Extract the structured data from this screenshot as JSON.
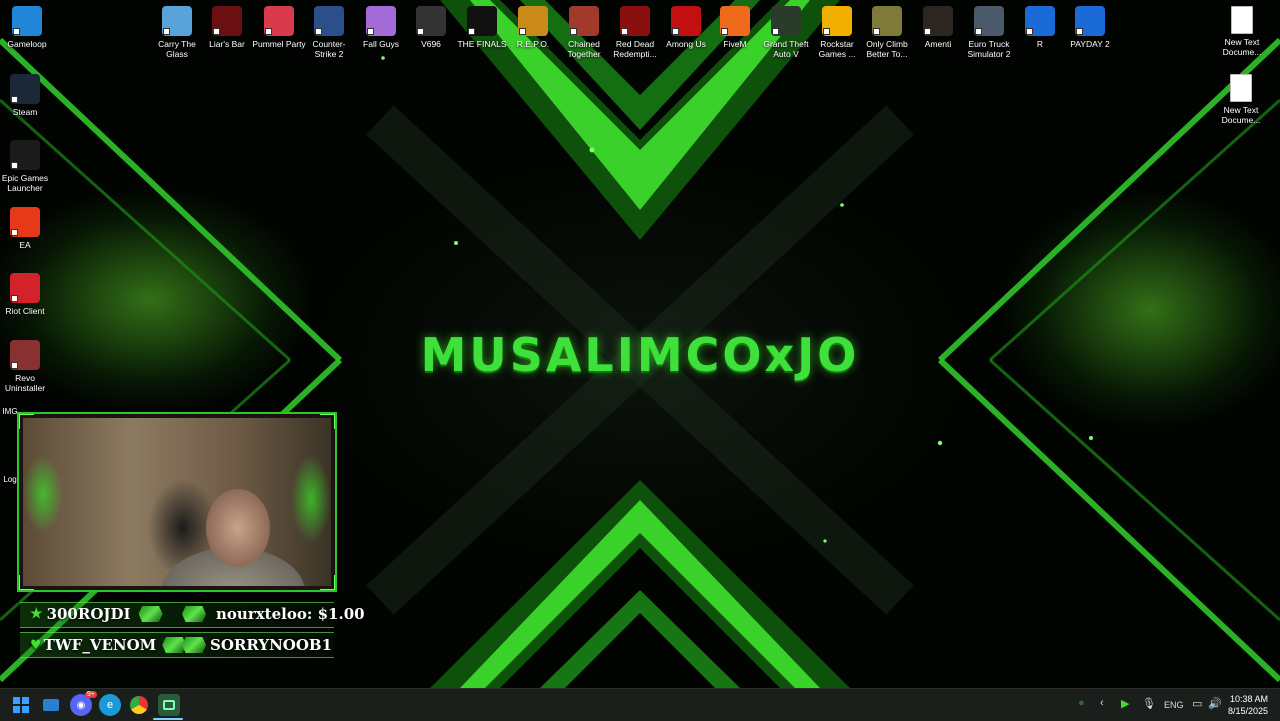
{
  "wallpaper": {
    "title": "MUSALIMCOxJO"
  },
  "desktop_icons_top": [
    {
      "label": "Gameloop",
      "icon": "gameloop-icon",
      "color": "#1f86d8"
    },
    {
      "label": "Carry The Glass",
      "icon": "carry-the-glass-icon",
      "color": "#5aa3d8"
    },
    {
      "label": "Liar's Bar",
      "icon": "liars-bar-icon",
      "color": "#6a0f12"
    },
    {
      "label": "Pummel Party",
      "icon": "pummel-party-icon",
      "color": "#d93a4e"
    },
    {
      "label": "Counter-Strike 2",
      "icon": "counter-strike-icon",
      "color": "#2a4f8a"
    },
    {
      "label": "Fall Guys",
      "icon": "fall-guys-icon",
      "color": "#a46ad8"
    },
    {
      "label": "V696",
      "icon": "v696-icon",
      "color": "#333333"
    },
    {
      "label": "THE FINALS",
      "icon": "the-finals-icon",
      "color": "#111111"
    },
    {
      "label": "R.E.P.O.",
      "icon": "repo-icon",
      "color": "#c98a1a"
    },
    {
      "label": "Chained Together",
      "icon": "chained-together-icon",
      "color": "#a13a2a"
    },
    {
      "label": "Red Dead Redempti...",
      "icon": "red-dead-icon",
      "color": "#8a1010"
    },
    {
      "label": "Among Us",
      "icon": "among-us-icon",
      "color": "#c21010"
    },
    {
      "label": "FiveM",
      "icon": "fivem-icon",
      "color": "#f06a1c"
    },
    {
      "label": "Grand Theft Auto V",
      "icon": "gta-v-icon",
      "color": "#2b3b2b"
    },
    {
      "label": "Rockstar Games ...",
      "icon": "rockstar-icon",
      "color": "#f1b000"
    },
    {
      "label": "Only Climb Better To...",
      "icon": "only-climb-icon",
      "color": "#7d7a3a"
    },
    {
      "label": "Amenti",
      "icon": "amenti-icon",
      "color": "#2c2520"
    },
    {
      "label": "Euro Truck Simulator 2",
      "icon": "euro-truck-icon",
      "color": "#4a5a6a"
    },
    {
      "label": "R",
      "icon": "rocket-league-icon",
      "color": "#1a6ad8"
    },
    {
      "label": "PAYDAY 2",
      "icon": "payday-icon",
      "color": "#1a6ad8"
    },
    {
      "label": "New Text Docume...",
      "icon": "text-document-icon",
      "color": "#ffffff"
    }
  ],
  "desktop_icons_left": [
    {
      "label": "Steam",
      "icon": "steam-icon",
      "color": "#1b2838"
    },
    {
      "label": "Epic Games Launcher",
      "icon": "epic-games-icon",
      "color": "#1b1b1b"
    },
    {
      "label": "EA",
      "icon": "ea-icon",
      "color": "#e8381a"
    },
    {
      "label": "Riot Client",
      "icon": "riot-client-icon",
      "color": "#d3222a"
    },
    {
      "label": "Revo Uninstaller",
      "icon": "revo-uninstaller-icon",
      "color": "#8a3030"
    }
  ],
  "desktop_icons_right2": {
    "label": "New Text Docume...",
    "icon": "text-document-icon"
  },
  "webcam": {
    "alerts": [
      {
        "left": "300ROJDI",
        "right": "nourxteloo: $1.00"
      },
      {
        "left": "TWF_VENOM",
        "right": "SORRYNOOB1"
      }
    ]
  },
  "taskbar": {
    "apps": [
      "start-icon",
      "file-explorer-icon",
      "discord-icon",
      "edge-icon",
      "chrome-icon",
      "streamlabs-icon"
    ],
    "discord_badge": "9+",
    "tray": {
      "language": "ENG"
    },
    "clock": {
      "time": "10:38 AM",
      "date": "8/15/2025"
    }
  }
}
